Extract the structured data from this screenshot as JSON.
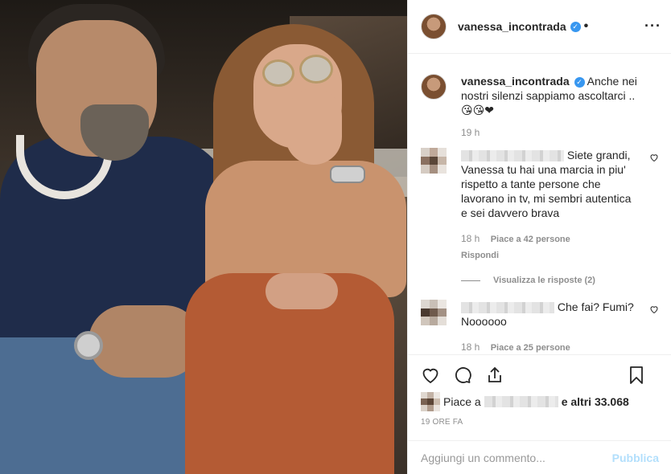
{
  "post": {
    "username": "vanessa_incontrada",
    "verified_icon": "verified-check-icon",
    "more_icon": "more-horizontal-icon"
  },
  "caption": {
    "username": "vanessa_incontrada",
    "text": "Anche nei nostri silenzi sappiamo ascoltarci .. 😘😘❤",
    "time": "19 h"
  },
  "comments": [
    {
      "text": "Siete grandi, Vanessa tu hai una marcia in piu' rispetto a tante persone che lavorano in tv, mi sembri autentica e sei davvero brava",
      "time": "18 h",
      "likes": "Piace a 42 persone",
      "reply": "Rispondi",
      "view_replies": "Visualizza le risposte (2)"
    },
    {
      "text": "Che fai? Fumi? Noooooo",
      "time": "18 h",
      "likes": "Piace a 25 persone"
    }
  ],
  "actions": {
    "like_icon": "heart-icon",
    "comment_icon": "comment-icon",
    "share_icon": "share-icon",
    "save_icon": "bookmark-icon"
  },
  "likes": {
    "prefix": "Piace a",
    "suffix": "e altri 33.068"
  },
  "time_ago": "19 ORE FA",
  "add_comment": {
    "placeholder": "Aggiungi un commento...",
    "publish": "Pubblica"
  },
  "colors": {
    "verified": "#3897f0",
    "publish_disabled": "#b2dffc",
    "muted": "#8e8e8e"
  }
}
